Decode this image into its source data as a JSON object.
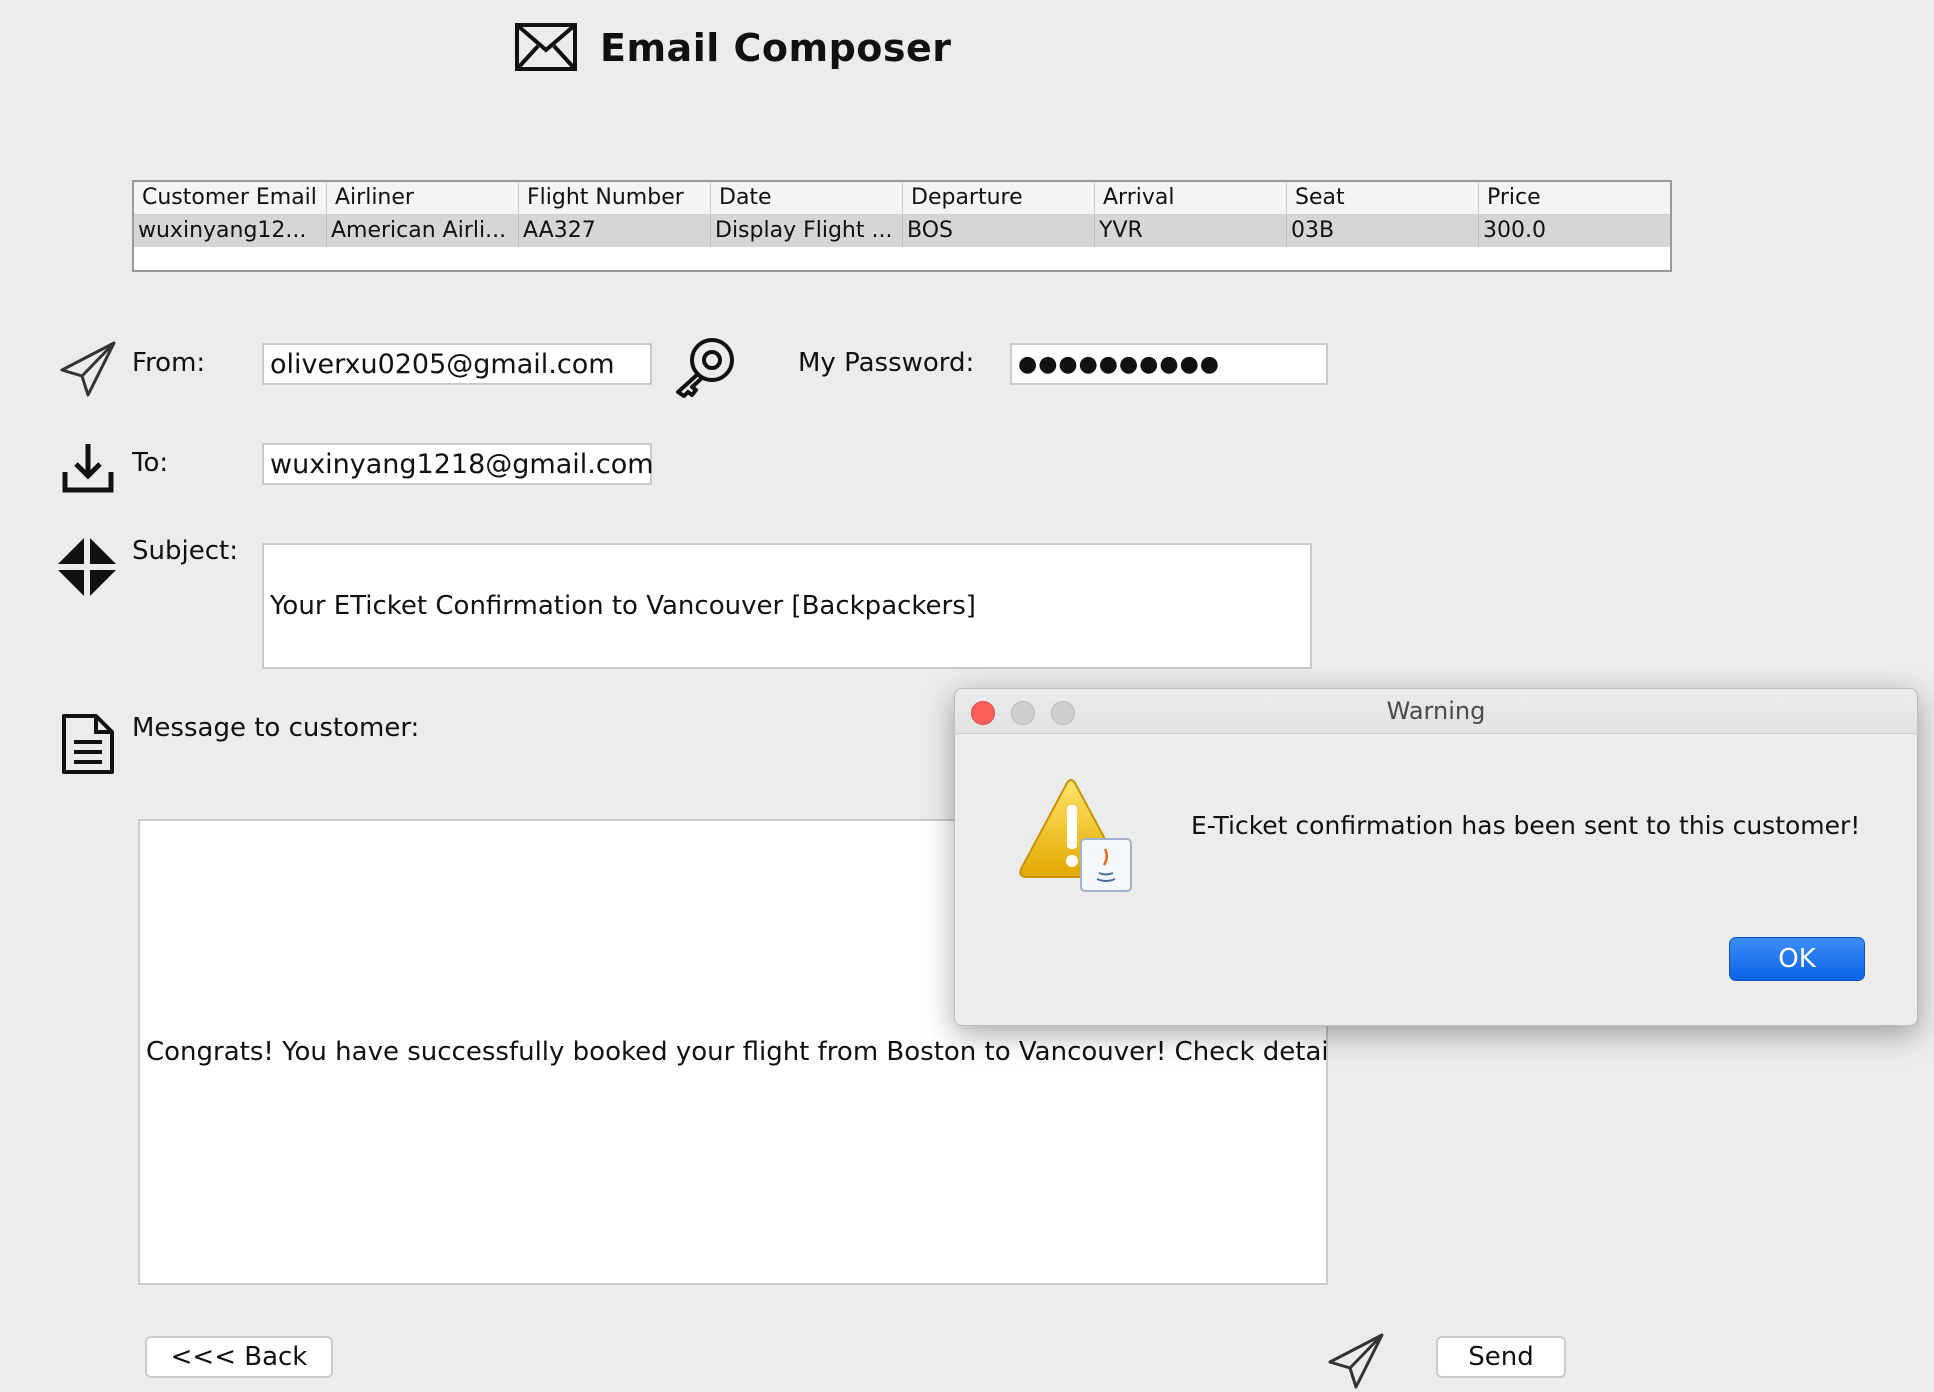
{
  "header": {
    "title": "Email Composer",
    "icon": "envelope-icon"
  },
  "table": {
    "columns": [
      "Customer Email",
      "Airliner",
      "Flight Number",
      "Date",
      "Departure",
      "Arrival",
      "Seat",
      "Price"
    ],
    "rows": [
      [
        "wuxinyang12...",
        "American Airli...",
        "AA327",
        "Display Flight ...",
        "BOS",
        "YVR",
        "03B",
        "300.0"
      ]
    ]
  },
  "form": {
    "from_label": "From:",
    "from_value": "oliverxu0205@gmail.com",
    "password_label": "My Password:",
    "password_value": "●●●●●●●●●●",
    "to_label": "To:",
    "to_value": "wuxinyang1218@gmail.com",
    "subject_label": "Subject:",
    "subject_value": "Your ETicket Confirmation to Vancouver [Backpackers]",
    "message_label": "Message to customer:",
    "message_value": "Congrats! You have successfully booked your flight from Boston to Vancouver! Check details:"
  },
  "buttons": {
    "back": "<<< Back",
    "send": "Send"
  },
  "dialog": {
    "title": "Warning",
    "message": "E-Ticket confirmation has been sent to this customer!",
    "ok": "OK"
  },
  "colors": {
    "accent": "#0b63e6",
    "close": "#fc605b",
    "traffic_inactive": "#cfcfcf"
  }
}
